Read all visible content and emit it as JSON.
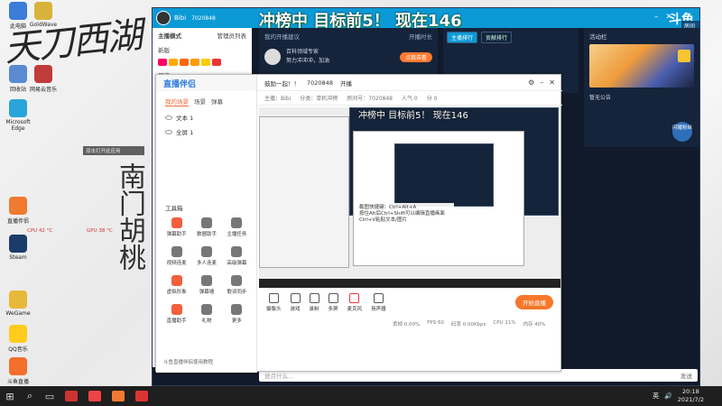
{
  "desktop": {
    "wall_title": "天刀西湖",
    "wall_vert": "南门胡桃",
    "icons": [
      {
        "label": "此电脑",
        "color": "#3b7dd8"
      },
      {
        "label": "GoldWave",
        "color": "#d8b23b"
      },
      {
        "label": "回收站",
        "color": "#5a8ad0"
      },
      {
        "label": "网易云音乐",
        "color": "#c23b3b"
      },
      {
        "label": "Microsoft Edge",
        "color": "#2aa5d9"
      },
      {
        "label": "Steam",
        "color": "#1b3c6b"
      },
      {
        "label": "直播伴侣",
        "color": "#f07a2f"
      },
      {
        "label": "WeGame",
        "color": "#e8b83a"
      },
      {
        "label": "QQ音乐",
        "color": "#ffcc1d"
      },
      {
        "label": "斗鱼直播",
        "color": "#f36f2b"
      }
    ],
    "toast": "双击打开此应用",
    "cpu1": "CPU 42 °C",
    "cpu2": "GPU 38 °C"
  },
  "douyu": {
    "user_name": "Bibi",
    "room_id": "7020848",
    "banner": "冲榜中 目标前5！ 现在146",
    "logo": "斗鱼",
    "rooms_label": "房间号",
    "rooms_value": "7020848",
    "left": {
      "title": "主播模式",
      "manage": "管理员列表",
      "new": "新版",
      "weekly": "周榜"
    },
    "mid": {
      "head": "我的开播建议",
      "action": "开播时长",
      "line1": "百科领域专家",
      "line2": "努力冲冲冲，加油",
      "pill": "点我去看"
    },
    "rank": {
      "tabs": [
        "主播排行",
        "贡献排行"
      ],
      "side_labels": [
        "上周排名",
        "本月排名"
      ]
    },
    "promo": {
      "head": "活动栏",
      "caption": "暂无公告",
      "follow_btn": "闪耀粉丝"
    },
    "chat_placeholder": "说点什么...",
    "chat_send": "发送"
  },
  "obs": {
    "brand": "直播伴侣",
    "tabs": [
      "我的场景",
      "场景",
      "弹幕"
    ],
    "scenes": [
      "文本 1",
      "全屏 1"
    ],
    "tools_title": "工具箱",
    "tools": [
      {
        "label": "弹幕助手",
        "red": true
      },
      {
        "label": "数据助手",
        "red": false
      },
      {
        "label": "主播任务",
        "red": false
      },
      {
        "label": "视频连麦",
        "red": false
      },
      {
        "label": "多人连麦",
        "red": false
      },
      {
        "label": "高级弹幕",
        "red": false
      },
      {
        "label": "虚拟形象",
        "red": true
      },
      {
        "label": "弹幕墙",
        "red": false
      },
      {
        "label": "歌词同步",
        "red": false
      },
      {
        "label": "直播助手",
        "red": true
      },
      {
        "label": "礼物",
        "red": false
      },
      {
        "label": "更多",
        "red": false
      }
    ],
    "foot": "斗鱼直播伴侣使用教程",
    "head_title": "鼓励一起！！",
    "head_room": "7020848",
    "head_tag": "开播",
    "sub": [
      "主播：Bibi",
      "分类：单机冲榜",
      "房间号：7020848",
      "人气 0",
      "分 0"
    ],
    "preview_title": "冲榜中 目标前5！ 现在146",
    "note": [
      "截图快捷键：Ctrl+Alt+A",
      "按住Alt后Ctrl+Shift可以编辑直播画面",
      "Ctrl+V粘贴文本/图片"
    ],
    "controls": [
      "摄像头",
      "游戏",
      "录制",
      "多屏",
      "麦克风",
      "扬声器"
    ],
    "go_button": "开始直播",
    "status": [
      "丢帧 0.00%",
      "FPS 60",
      "码率 0.00Kbps",
      "CPU 11%",
      "内存 40%"
    ]
  },
  "taskbar": {
    "time": "20:18",
    "date": "2021/7/2",
    "tray": [
      "英",
      "40"
    ]
  }
}
